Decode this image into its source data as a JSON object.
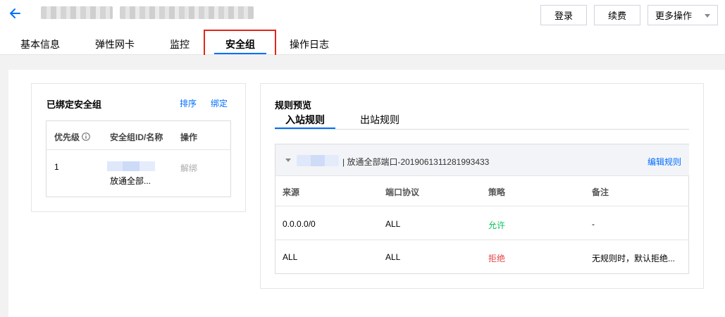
{
  "header": {
    "buttons": {
      "login": "登录",
      "renew": "续费",
      "more": "更多操作"
    }
  },
  "tabs": [
    {
      "label": "基本信息"
    },
    {
      "label": "弹性网卡"
    },
    {
      "label": "监控"
    },
    {
      "label": "安全组"
    },
    {
      "label": "操作日志"
    }
  ],
  "bound_sg": {
    "title": "已绑定安全组",
    "sort_link": "排序",
    "bind_link": "绑定",
    "columns": [
      "优先级",
      "安全组ID/名称",
      "操作"
    ],
    "rows": [
      {
        "priority": "1",
        "name": "放通全部...",
        "action": "解绑"
      }
    ]
  },
  "rules": {
    "title": "规则预览",
    "tabs": [
      "入站规则",
      "出站规则"
    ],
    "group_label": "| 放通全部端口-2019061311281993433",
    "edit_link": "编辑规则",
    "columns": [
      "来源",
      "端口协议",
      "策略",
      "备注"
    ],
    "rows": [
      {
        "source": "0.0.0.0/0",
        "port": "ALL",
        "policy": "允许",
        "remark": "-"
      },
      {
        "source": "ALL",
        "port": "ALL",
        "policy": "拒绝",
        "remark": "无规则时，默认拒绝..."
      }
    ]
  },
  "colors": {
    "accent": "#006eff",
    "allow": "#0abf5b",
    "deny": "#e54545",
    "highlight_box": "#e1261c"
  }
}
